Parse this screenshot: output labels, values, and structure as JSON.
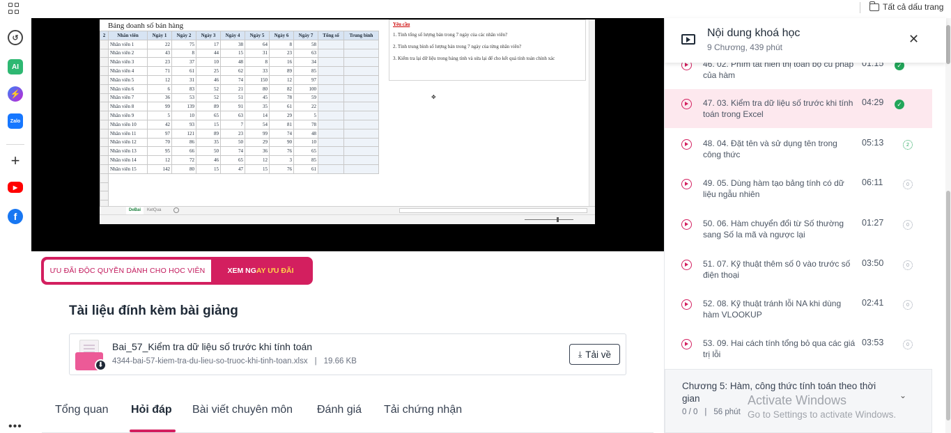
{
  "browser": {
    "bookmarks_label": "Tất cả dấu trang"
  },
  "sidebar_icons": [
    {
      "name": "history-icon",
      "glyph": "↺"
    },
    {
      "name": "ai-icon",
      "glyph": "AI"
    },
    {
      "name": "messenger-icon",
      "glyph": "⚡"
    },
    {
      "name": "zalo-icon",
      "glyph": "Zalo"
    },
    {
      "name": "add-icon",
      "glyph": "+"
    },
    {
      "name": "youtube-icon",
      "glyph": "▶"
    },
    {
      "name": "facebook-icon",
      "glyph": "f"
    }
  ],
  "sheet": {
    "title": "Bảng doanh số bán hàng",
    "headers": [
      "Nhân viên",
      "Ngày 1",
      "Ngày 2",
      "Ngày 3",
      "Ngày 4",
      "Ngày 5",
      "Ngày 6",
      "Ngày 7",
      "Tổng số",
      "Trung bình"
    ],
    "rows": [
      [
        "Nhân viên 1",
        "22",
        "75",
        "17",
        "38",
        "64",
        "8",
        "58"
      ],
      [
        "Nhân viên 2",
        "43",
        "8",
        "44",
        "15",
        "31",
        "23",
        "63"
      ],
      [
        "Nhân viên 3",
        "23",
        "37",
        "10",
        "48",
        "8",
        "16",
        "34"
      ],
      [
        "Nhân viên 4",
        "71",
        "61",
        "25",
        "62",
        "33",
        "89",
        "85"
      ],
      [
        "Nhân viên 5",
        "12",
        "31",
        "46",
        "74",
        "150",
        "12",
        "97"
      ],
      [
        "Nhân viên 6",
        "6",
        "83",
        "52",
        "21",
        "80",
        "82",
        "100"
      ],
      [
        "Nhân viên 7",
        "36",
        "53",
        "52",
        "51",
        "45",
        "78",
        "59"
      ],
      [
        "Nhân viên 8",
        "99",
        "139",
        "89",
        "91",
        "35",
        "61",
        "22"
      ],
      [
        "Nhân viên 9",
        "5",
        "10",
        "65",
        "63",
        "14",
        "29",
        "5"
      ],
      [
        "Nhân viên 10",
        "42",
        "93",
        "15",
        "7",
        "54",
        "81",
        "78"
      ],
      [
        "Nhân viên 11",
        "97",
        "121",
        "89",
        "23",
        "99",
        "74",
        "48"
      ],
      [
        "Nhân viên 12",
        "70",
        "86",
        "35",
        "50",
        "29",
        "90",
        "10"
      ],
      [
        "Nhân viên 13",
        "95",
        "66",
        "50",
        "74",
        "36",
        "76",
        "65"
      ],
      [
        "Nhân viên 14",
        "12",
        "72",
        "46",
        "65",
        "12",
        "3",
        "85"
      ],
      [
        "Nhân viên 15",
        "142",
        "80",
        "15",
        "47",
        "15",
        "76",
        "61"
      ]
    ],
    "requirements_title": "Yêu cầu",
    "requirements": [
      "1. Tính tổng số lượng bán trong 7 ngày của các nhân viên?",
      "2. Tính trung bình số lượng bán trong 7 ngày của từng nhân viên?",
      "3. Kiểm tra lại dữ liệu trong bảng tính và sửa lại để cho kết quả tính toán chính xác"
    ],
    "tab_active": "DeBai",
    "tab_other": "KetQua"
  },
  "promo": {
    "left": "ƯU ĐÃI ĐỘC QUYỀN DÀNH CHO HỌC VIÊN",
    "right_a": "XEM NG",
    "right_b": "AY ƯU ĐÃI"
  },
  "attachments": {
    "title": "Tài liệu đính kèm bài giảng",
    "file_name": "Bai_57_Kiểm tra dữ liệu số trước khi tính toán",
    "file_path": "4344-bai-57-kiem-tra-du-lieu-so-truoc-khi-tinh-toan.xlsx",
    "separator": "|",
    "file_size": "19.66 KB",
    "download_label": "Tải về"
  },
  "tabs": [
    {
      "label": "Tổng quan",
      "active": false
    },
    {
      "label": "Hỏi đáp",
      "active": true
    },
    {
      "label": "Bài viết chuyên môn",
      "active": false
    },
    {
      "label": "Đánh giá",
      "active": false
    },
    {
      "label": "Tải chứng nhận",
      "active": false
    }
  ],
  "course": {
    "title": "Nội dung khoá học",
    "subtitle": "9 Chương, 439 phút",
    "close_glyph": "✕",
    "lessons": [
      {
        "title": "46. 02. Phím tắt hiển thị toàn bộ cú pháp của hàm",
        "duration": "01:15",
        "status": "done",
        "status_text": "✓"
      },
      {
        "title": "47. 03. Kiểm tra dữ liệu số trước khi tính toán trong Excel",
        "duration": "04:29",
        "status": "done",
        "status_text": "✓",
        "current": true
      },
      {
        "title": "48. 04. Đặt tên và sử dụng tên trong công thức",
        "duration": "05:13",
        "status": "partial",
        "status_text": "2"
      },
      {
        "title": "49. 05. Dùng hàm tạo bảng tính có dữ liệu ngẫu nhiên",
        "duration": "06:11",
        "status": "none",
        "status_text": "0"
      },
      {
        "title": "50. 06. Hàm chuyển đổi từ Số thường sang Số la mã và ngược lại",
        "duration": "01:27",
        "status": "none",
        "status_text": "0"
      },
      {
        "title": "51. 07. Kỹ thuật thêm số 0 vào trước số điện thoại",
        "duration": "03:50",
        "status": "none",
        "status_text": "0"
      },
      {
        "title": "52. 08. Kỹ thuật tránh lỗi NA khi dùng hàm VLOOKUP",
        "duration": "02:41",
        "status": "none",
        "status_text": "0"
      },
      {
        "title": "53. 09. Hai cách tính tổng bỏ qua các giá trị lỗi",
        "duration": "03:53",
        "status": "none",
        "status_text": "0"
      }
    ],
    "chapter": {
      "title": "Chương 5: Hàm, công thức tính toán theo thời gian",
      "progress": "0 / 0",
      "separator": "|",
      "duration": "56 phút",
      "chevron": "⌄"
    }
  },
  "watermark": {
    "line1": "Activate Windows",
    "line2": "Go to Settings to activate Windows."
  },
  "colors": {
    "accent": "#d31f5f",
    "done": "#22a65a",
    "current_bg": "#fde8ee"
  }
}
